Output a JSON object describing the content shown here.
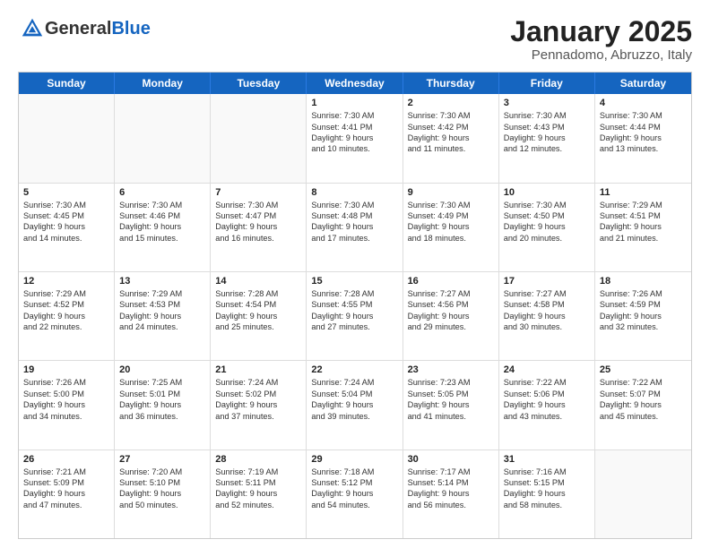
{
  "logo": {
    "general": "General",
    "blue": "Blue"
  },
  "title": {
    "month": "January 2025",
    "location": "Pennadomo, Abruzzo, Italy"
  },
  "days": [
    "Sunday",
    "Monday",
    "Tuesday",
    "Wednesday",
    "Thursday",
    "Friday",
    "Saturday"
  ],
  "rows": [
    [
      {
        "day": "",
        "lines": [],
        "empty": true
      },
      {
        "day": "",
        "lines": [],
        "empty": true
      },
      {
        "day": "",
        "lines": [],
        "empty": true
      },
      {
        "day": "1",
        "lines": [
          "Sunrise: 7:30 AM",
          "Sunset: 4:41 PM",
          "Daylight: 9 hours",
          "and 10 minutes."
        ]
      },
      {
        "day": "2",
        "lines": [
          "Sunrise: 7:30 AM",
          "Sunset: 4:42 PM",
          "Daylight: 9 hours",
          "and 11 minutes."
        ]
      },
      {
        "day": "3",
        "lines": [
          "Sunrise: 7:30 AM",
          "Sunset: 4:43 PM",
          "Daylight: 9 hours",
          "and 12 minutes."
        ]
      },
      {
        "day": "4",
        "lines": [
          "Sunrise: 7:30 AM",
          "Sunset: 4:44 PM",
          "Daylight: 9 hours",
          "and 13 minutes."
        ]
      }
    ],
    [
      {
        "day": "5",
        "lines": [
          "Sunrise: 7:30 AM",
          "Sunset: 4:45 PM",
          "Daylight: 9 hours",
          "and 14 minutes."
        ]
      },
      {
        "day": "6",
        "lines": [
          "Sunrise: 7:30 AM",
          "Sunset: 4:46 PM",
          "Daylight: 9 hours",
          "and 15 minutes."
        ]
      },
      {
        "day": "7",
        "lines": [
          "Sunrise: 7:30 AM",
          "Sunset: 4:47 PM",
          "Daylight: 9 hours",
          "and 16 minutes."
        ]
      },
      {
        "day": "8",
        "lines": [
          "Sunrise: 7:30 AM",
          "Sunset: 4:48 PM",
          "Daylight: 9 hours",
          "and 17 minutes."
        ]
      },
      {
        "day": "9",
        "lines": [
          "Sunrise: 7:30 AM",
          "Sunset: 4:49 PM",
          "Daylight: 9 hours",
          "and 18 minutes."
        ]
      },
      {
        "day": "10",
        "lines": [
          "Sunrise: 7:30 AM",
          "Sunset: 4:50 PM",
          "Daylight: 9 hours",
          "and 20 minutes."
        ]
      },
      {
        "day": "11",
        "lines": [
          "Sunrise: 7:29 AM",
          "Sunset: 4:51 PM",
          "Daylight: 9 hours",
          "and 21 minutes."
        ]
      }
    ],
    [
      {
        "day": "12",
        "lines": [
          "Sunrise: 7:29 AM",
          "Sunset: 4:52 PM",
          "Daylight: 9 hours",
          "and 22 minutes."
        ]
      },
      {
        "day": "13",
        "lines": [
          "Sunrise: 7:29 AM",
          "Sunset: 4:53 PM",
          "Daylight: 9 hours",
          "and 24 minutes."
        ]
      },
      {
        "day": "14",
        "lines": [
          "Sunrise: 7:28 AM",
          "Sunset: 4:54 PM",
          "Daylight: 9 hours",
          "and 25 minutes."
        ]
      },
      {
        "day": "15",
        "lines": [
          "Sunrise: 7:28 AM",
          "Sunset: 4:55 PM",
          "Daylight: 9 hours",
          "and 27 minutes."
        ]
      },
      {
        "day": "16",
        "lines": [
          "Sunrise: 7:27 AM",
          "Sunset: 4:56 PM",
          "Daylight: 9 hours",
          "and 29 minutes."
        ]
      },
      {
        "day": "17",
        "lines": [
          "Sunrise: 7:27 AM",
          "Sunset: 4:58 PM",
          "Daylight: 9 hours",
          "and 30 minutes."
        ]
      },
      {
        "day": "18",
        "lines": [
          "Sunrise: 7:26 AM",
          "Sunset: 4:59 PM",
          "Daylight: 9 hours",
          "and 32 minutes."
        ]
      }
    ],
    [
      {
        "day": "19",
        "lines": [
          "Sunrise: 7:26 AM",
          "Sunset: 5:00 PM",
          "Daylight: 9 hours",
          "and 34 minutes."
        ]
      },
      {
        "day": "20",
        "lines": [
          "Sunrise: 7:25 AM",
          "Sunset: 5:01 PM",
          "Daylight: 9 hours",
          "and 36 minutes."
        ]
      },
      {
        "day": "21",
        "lines": [
          "Sunrise: 7:24 AM",
          "Sunset: 5:02 PM",
          "Daylight: 9 hours",
          "and 37 minutes."
        ]
      },
      {
        "day": "22",
        "lines": [
          "Sunrise: 7:24 AM",
          "Sunset: 5:04 PM",
          "Daylight: 9 hours",
          "and 39 minutes."
        ]
      },
      {
        "day": "23",
        "lines": [
          "Sunrise: 7:23 AM",
          "Sunset: 5:05 PM",
          "Daylight: 9 hours",
          "and 41 minutes."
        ]
      },
      {
        "day": "24",
        "lines": [
          "Sunrise: 7:22 AM",
          "Sunset: 5:06 PM",
          "Daylight: 9 hours",
          "and 43 minutes."
        ]
      },
      {
        "day": "25",
        "lines": [
          "Sunrise: 7:22 AM",
          "Sunset: 5:07 PM",
          "Daylight: 9 hours",
          "and 45 minutes."
        ]
      }
    ],
    [
      {
        "day": "26",
        "lines": [
          "Sunrise: 7:21 AM",
          "Sunset: 5:09 PM",
          "Daylight: 9 hours",
          "and 47 minutes."
        ]
      },
      {
        "day": "27",
        "lines": [
          "Sunrise: 7:20 AM",
          "Sunset: 5:10 PM",
          "Daylight: 9 hours",
          "and 50 minutes."
        ]
      },
      {
        "day": "28",
        "lines": [
          "Sunrise: 7:19 AM",
          "Sunset: 5:11 PM",
          "Daylight: 9 hours",
          "and 52 minutes."
        ]
      },
      {
        "day": "29",
        "lines": [
          "Sunrise: 7:18 AM",
          "Sunset: 5:12 PM",
          "Daylight: 9 hours",
          "and 54 minutes."
        ]
      },
      {
        "day": "30",
        "lines": [
          "Sunrise: 7:17 AM",
          "Sunset: 5:14 PM",
          "Daylight: 9 hours",
          "and 56 minutes."
        ]
      },
      {
        "day": "31",
        "lines": [
          "Sunrise: 7:16 AM",
          "Sunset: 5:15 PM",
          "Daylight: 9 hours",
          "and 58 minutes."
        ]
      },
      {
        "day": "",
        "lines": [],
        "empty": true
      }
    ]
  ]
}
